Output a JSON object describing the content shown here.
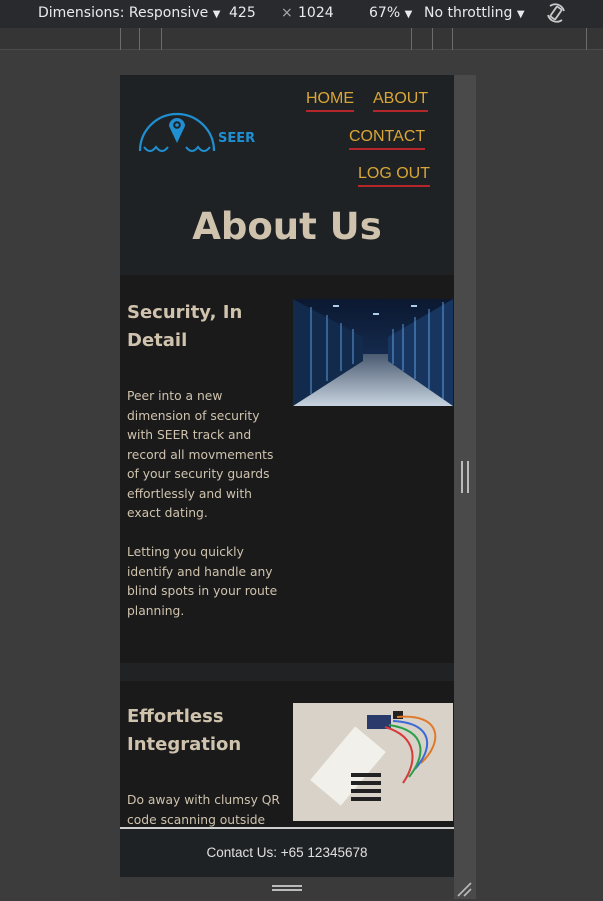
{
  "devtools": {
    "dimensions_label": "Dimensions: Responsive",
    "width_value": "425",
    "times_sign": "×",
    "height_value": "1024",
    "zoom": "67%",
    "throttle": "No throttling"
  },
  "site": {
    "logo_text": "SEER",
    "nav": [
      "HOME",
      "ABOUT",
      "CONTACT",
      "LOG OUT"
    ],
    "page_title": "About Us",
    "sections": [
      {
        "title": "Security, In Detail",
        "paragraphs": [
          "Peer into a new dimension of security with SEER track and record all movmements of your security guards effortlessly and with exact dating.",
          "Letting you quickly identify and handle any blind spots in your route planning."
        ]
      },
      {
        "title": "Effortless Integration",
        "paragraphs": [
          "Do away with clumsy QR code scanning outside"
        ]
      }
    ],
    "footer": "Contact Us: +65 12345678"
  },
  "colors": {
    "accent": "#d9a637",
    "underline": "#b3262a",
    "heading": "#cfc3ae",
    "logo_blue": "#1f8fd1"
  }
}
